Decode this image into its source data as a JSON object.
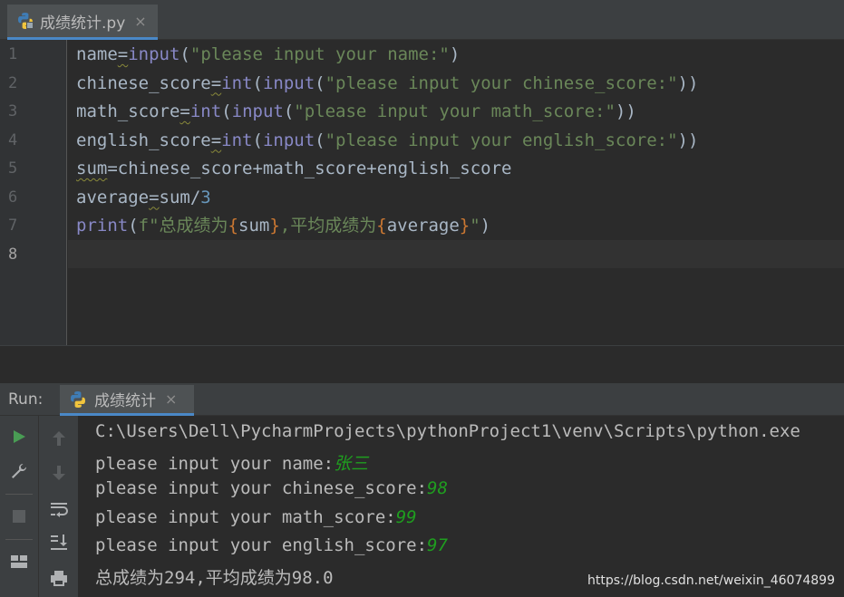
{
  "editor_tab": {
    "title": "成绩统计.py",
    "close": "×"
  },
  "code": {
    "line_numbers": [
      "1",
      "2",
      "3",
      "4",
      "5",
      "6",
      "7",
      "8"
    ],
    "lines": [
      [
        {
          "t": "name",
          "c": "fv"
        },
        {
          "t": "=",
          "c": "fv squig"
        },
        {
          "t": "input",
          "c": "b"
        },
        {
          "t": "(",
          "c": "fv"
        },
        {
          "t": "\"please input your name:\"",
          "c": "s"
        },
        {
          "t": ")",
          "c": "fv"
        }
      ],
      [
        {
          "t": "chinese_score",
          "c": "fv"
        },
        {
          "t": "=",
          "c": "fv squig"
        },
        {
          "t": "int",
          "c": "b"
        },
        {
          "t": "(",
          "c": "fv"
        },
        {
          "t": "input",
          "c": "b"
        },
        {
          "t": "(",
          "c": "fv"
        },
        {
          "t": "\"please input your chinese_score:\"",
          "c": "s"
        },
        {
          "t": "))",
          "c": "fv"
        }
      ],
      [
        {
          "t": "math_score",
          "c": "fv"
        },
        {
          "t": "=",
          "c": "fv squig"
        },
        {
          "t": "int",
          "c": "b"
        },
        {
          "t": "(",
          "c": "fv"
        },
        {
          "t": "input",
          "c": "b"
        },
        {
          "t": "(",
          "c": "fv"
        },
        {
          "t": "\"please input your math_score:\"",
          "c": "s"
        },
        {
          "t": "))",
          "c": "fv"
        }
      ],
      [
        {
          "t": "english_score",
          "c": "fv"
        },
        {
          "t": "=",
          "c": "fv squig"
        },
        {
          "t": "int",
          "c": "b"
        },
        {
          "t": "(",
          "c": "fv"
        },
        {
          "t": "input",
          "c": "b"
        },
        {
          "t": "(",
          "c": "fv"
        },
        {
          "t": "\"please input your english_score:\"",
          "c": "s"
        },
        {
          "t": "))",
          "c": "fv"
        }
      ],
      [
        {
          "t": "sum",
          "c": "fv squig"
        },
        {
          "t": "=chinese_score+math_score+english_score",
          "c": "fv"
        }
      ],
      [
        {
          "t": "average",
          "c": "fv"
        },
        {
          "t": "=",
          "c": "fv squig"
        },
        {
          "t": "sum/",
          "c": "fv"
        },
        {
          "t": "3",
          "c": "n"
        }
      ],
      [
        {
          "t": "print",
          "c": "b"
        },
        {
          "t": "(",
          "c": "fv"
        },
        {
          "t": "f\"总成绩为",
          "c": "s"
        },
        {
          "t": "{",
          "c": "brace"
        },
        {
          "t": "sum",
          "c": "fv"
        },
        {
          "t": "}",
          "c": "brace"
        },
        {
          "t": ",平均成绩为",
          "c": "s"
        },
        {
          "t": "{",
          "c": "brace"
        },
        {
          "t": "average",
          "c": "fv"
        },
        {
          "t": "}",
          "c": "brace"
        },
        {
          "t": "\"",
          "c": "s"
        },
        {
          "t": ")",
          "c": "fv"
        }
      ],
      []
    ]
  },
  "run_panel": {
    "label": "Run:",
    "tab_title": "成绩统计",
    "close": "×"
  },
  "console": {
    "path": "C:\\Users\\Dell\\PycharmProjects\\pythonProject1\\venv\\Scripts\\python.exe",
    "prompts": [
      {
        "prompt": "please input your name:",
        "input": "张三"
      },
      {
        "prompt": "please input your chinese_score:",
        "input": "98"
      },
      {
        "prompt": "please input your math_score:",
        "input": "99"
      },
      {
        "prompt": "please input your english_score:",
        "input": "97"
      }
    ],
    "result": "总成绩为294,平均成绩为98.0"
  },
  "watermark": "https://blog.csdn.net/weixin_46074899",
  "colors": {
    "keyword": "#cc7832",
    "builtin": "#8888c6",
    "string": "#6a8759",
    "number": "#6897bb",
    "user_input": "#1f9e1f",
    "run_green": "#499c54",
    "tab_underline": "#4a88c7"
  },
  "toolbar_icons": [
    "run-icon",
    "wrench-icon",
    "stop-icon",
    "layout-icon",
    "up-arrow-icon",
    "down-arrow-icon",
    "soft-wrap-icon",
    "scroll-to-end-icon",
    "print-icon"
  ]
}
